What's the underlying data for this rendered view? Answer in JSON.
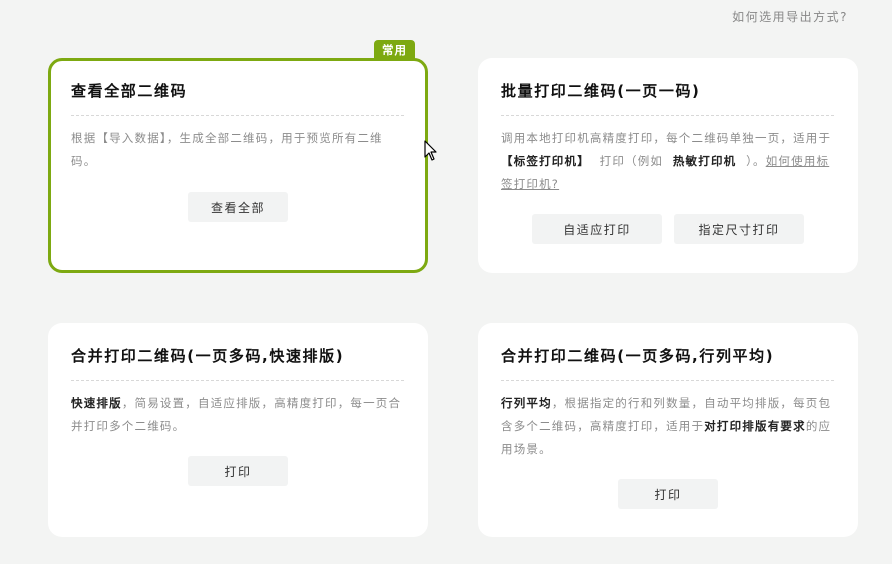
{
  "help_link": "如何选用导出方式?",
  "colors": {
    "accent": "#7da911",
    "background": "#f3f4f3"
  },
  "cards": [
    {
      "badge": "常用",
      "title": "查看全部二维码",
      "desc": "根据【导入数据】，生成全部二维码，用于预览所有二维码。",
      "buttons": [
        "查看全部"
      ]
    },
    {
      "title": "批量打印二维码(一页一码)",
      "desc_parts": [
        "调用本地打印机高精度打印，每个二维码单独一页，适用于",
        "【标签打印机】",
        "打印（例如",
        "热敏打印机",
        "）。",
        "如何使用标签打印机?"
      ],
      "buttons": [
        "自适应打印",
        "指定尺寸打印"
      ]
    },
    {
      "title": "合并打印二维码(一页多码,快速排版)",
      "desc_parts": [
        "快速排版",
        "，简易设置，自适应排版，高精度打印，每一页合并打印多个二维码。"
      ],
      "buttons": [
        "打印"
      ]
    },
    {
      "title": "合并打印二维码(一页多码,行列平均)",
      "desc_parts": [
        "行列平均",
        "，根据指定的行和列数量，自动平均排版，每页包含多个二维码，高精度打印，适用于",
        "对打印排版有要求",
        "的应用场景。"
      ],
      "buttons": [
        "打印"
      ]
    }
  ]
}
